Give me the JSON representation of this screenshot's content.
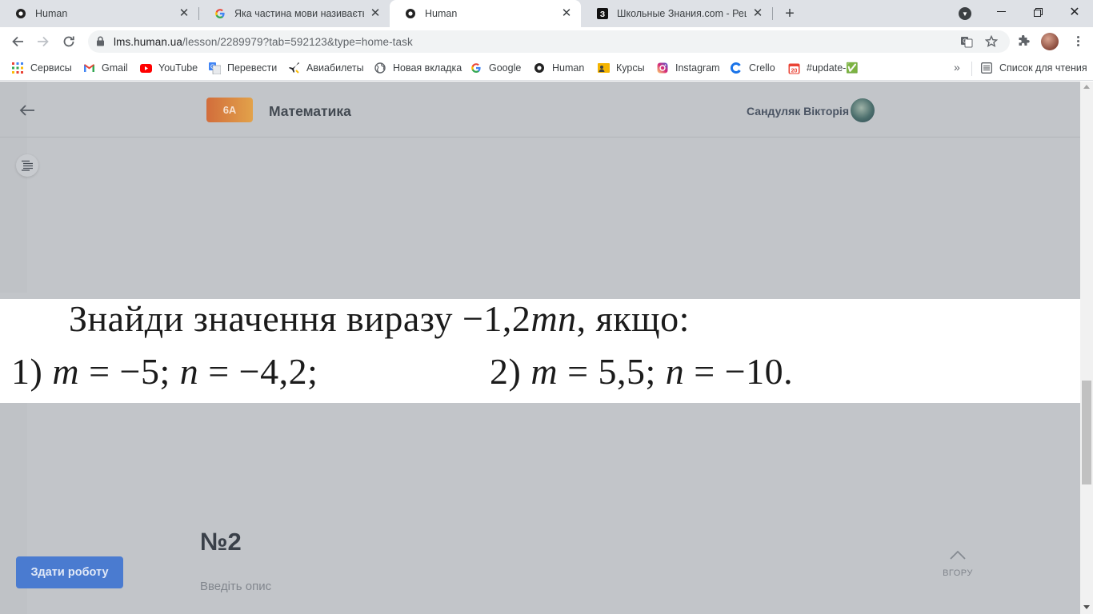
{
  "browser": {
    "tabs": [
      {
        "title": "Human",
        "icon": "human-icon",
        "active": false
      },
      {
        "title": "Яка частина мови називається ч",
        "icon": "google-icon",
        "active": false
      },
      {
        "title": "Human",
        "icon": "human-icon",
        "active": true
      },
      {
        "title": "Школьные Знания.com - Решае",
        "icon": "znanija-icon",
        "active": false
      }
    ],
    "url_host": "lms.human.ua",
    "url_path": "/lesson/2289979?tab=592123&type=home-task"
  },
  "bookmarks": [
    {
      "label": "Сервисы",
      "icon": "apps-grid-icon"
    },
    {
      "label": "Gmail",
      "icon": "gmail-icon"
    },
    {
      "label": "YouTube",
      "icon": "youtube-icon"
    },
    {
      "label": "Перевести",
      "icon": "translate-icon"
    },
    {
      "label": "Авиабилеты",
      "icon": "plane-icon"
    },
    {
      "label": "Новая вкладка",
      "icon": "globe-icon"
    },
    {
      "label": "Google",
      "icon": "google-icon"
    },
    {
      "label": "Human",
      "icon": "human-icon"
    },
    {
      "label": "Курсы",
      "icon": "courses-icon"
    },
    {
      "label": "Instagram",
      "icon": "instagram-icon"
    },
    {
      "label": "Crello",
      "icon": "crello-icon"
    },
    {
      "label": "#update-✅",
      "icon": "calendar-icon"
    }
  ],
  "reading_list": "Список для чтения",
  "header": {
    "class_badge": "6А",
    "subject": "Математика",
    "user_name": "Сандуляк Вікторія"
  },
  "problem": {
    "line1_text": "Знайди значення виразу −1,2",
    "line1_var": "mn",
    "line1_tail": ", якщо:",
    "part1_num": "1) ",
    "part1_m": "m",
    "part1_m_val": " = −5; ",
    "part1_n": "n",
    "part1_n_val": " = −4,2;",
    "part2_num": "2) ",
    "part2_m": "m",
    "part2_m_val": " = 5,5; ",
    "part2_n": "n",
    "part2_n_val": " = −10."
  },
  "task": {
    "number": "№2",
    "description": "Введіть опис"
  },
  "buttons": {
    "submit": "Здати роботу",
    "to_top": "ВГОРУ"
  }
}
